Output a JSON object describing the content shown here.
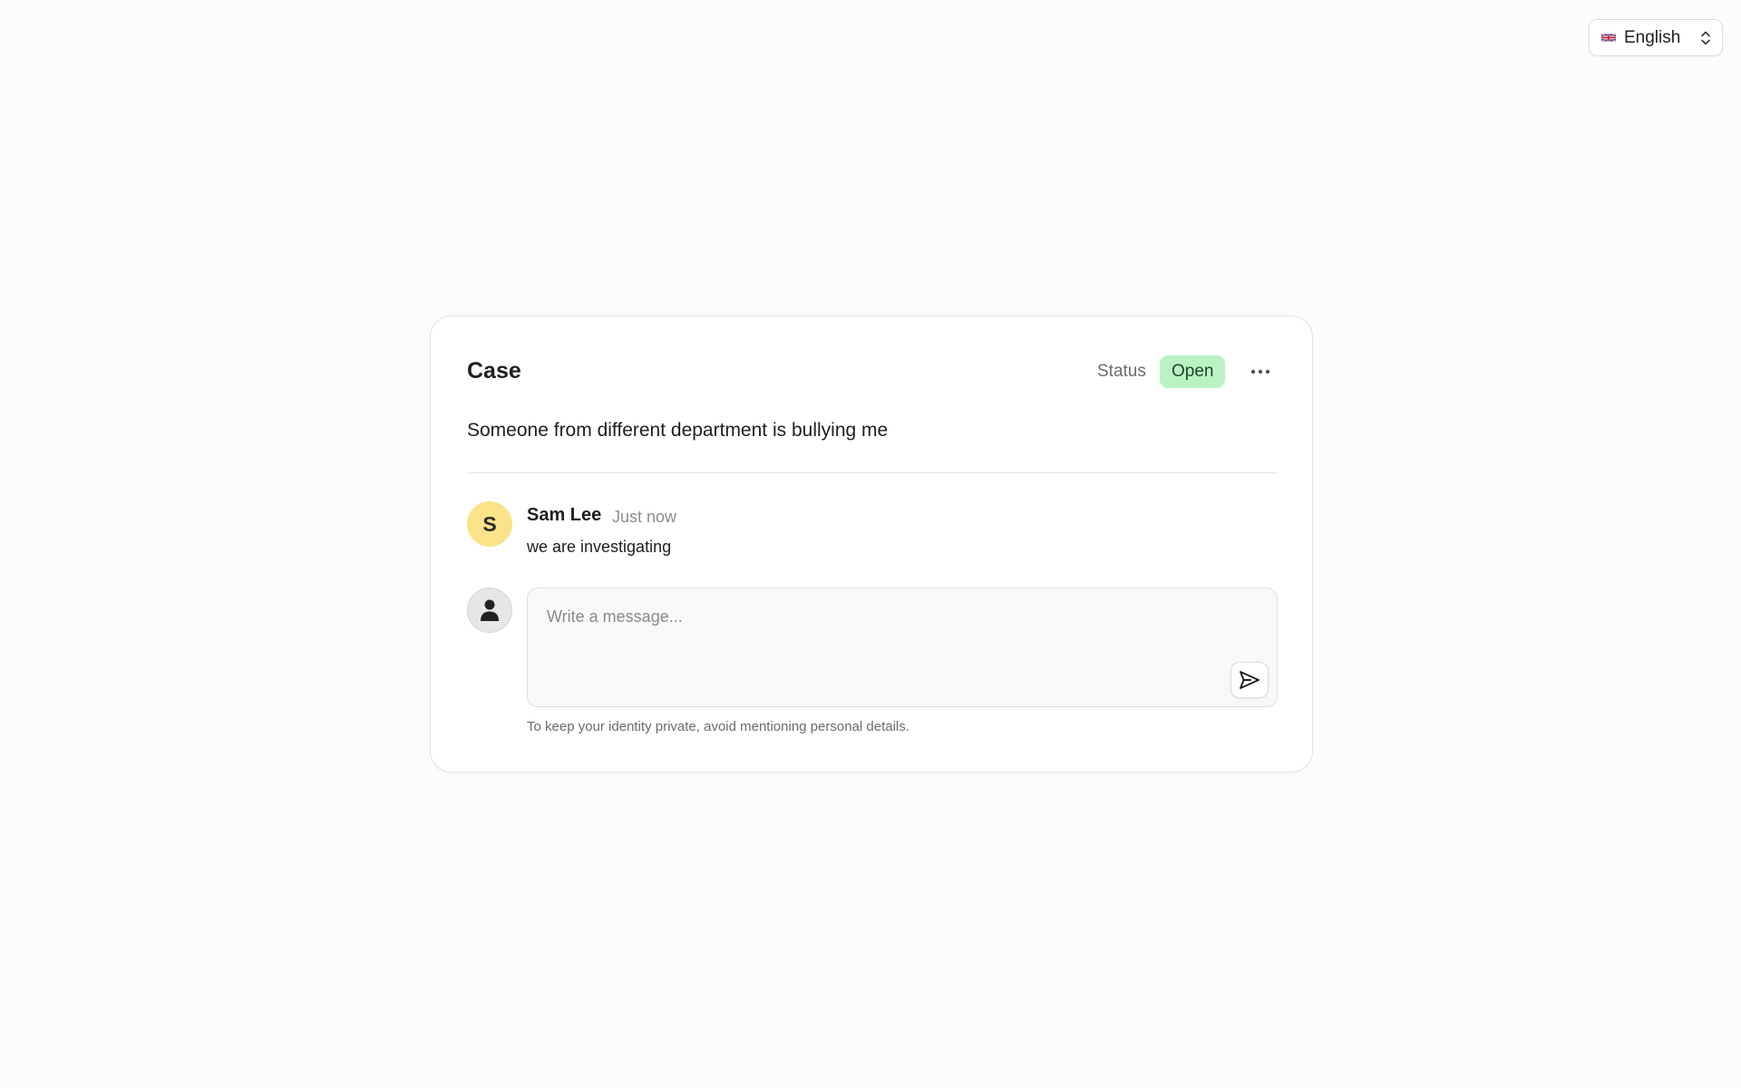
{
  "language_selector": {
    "label": "English",
    "flag_icon": "uk-flag-icon",
    "chevron_icon": "chevron-up-down-icon"
  },
  "case": {
    "title": "Case",
    "status_label": "Status",
    "status_value": "Open",
    "status_color": "#bbf2c4",
    "more_icon": "ellipsis-icon",
    "description": "Someone from different department is bullying me"
  },
  "comments": [
    {
      "avatar_initial": "S",
      "avatar_color": "#fbe38a",
      "author": "Sam Lee",
      "time": "Just now",
      "text": "we are investigating"
    }
  ],
  "composer": {
    "placeholder": "Write a message...",
    "value": "",
    "user_icon": "user-icon",
    "send_icon": "send-icon",
    "privacy_note": "To keep your identity private, avoid mentioning personal details."
  }
}
